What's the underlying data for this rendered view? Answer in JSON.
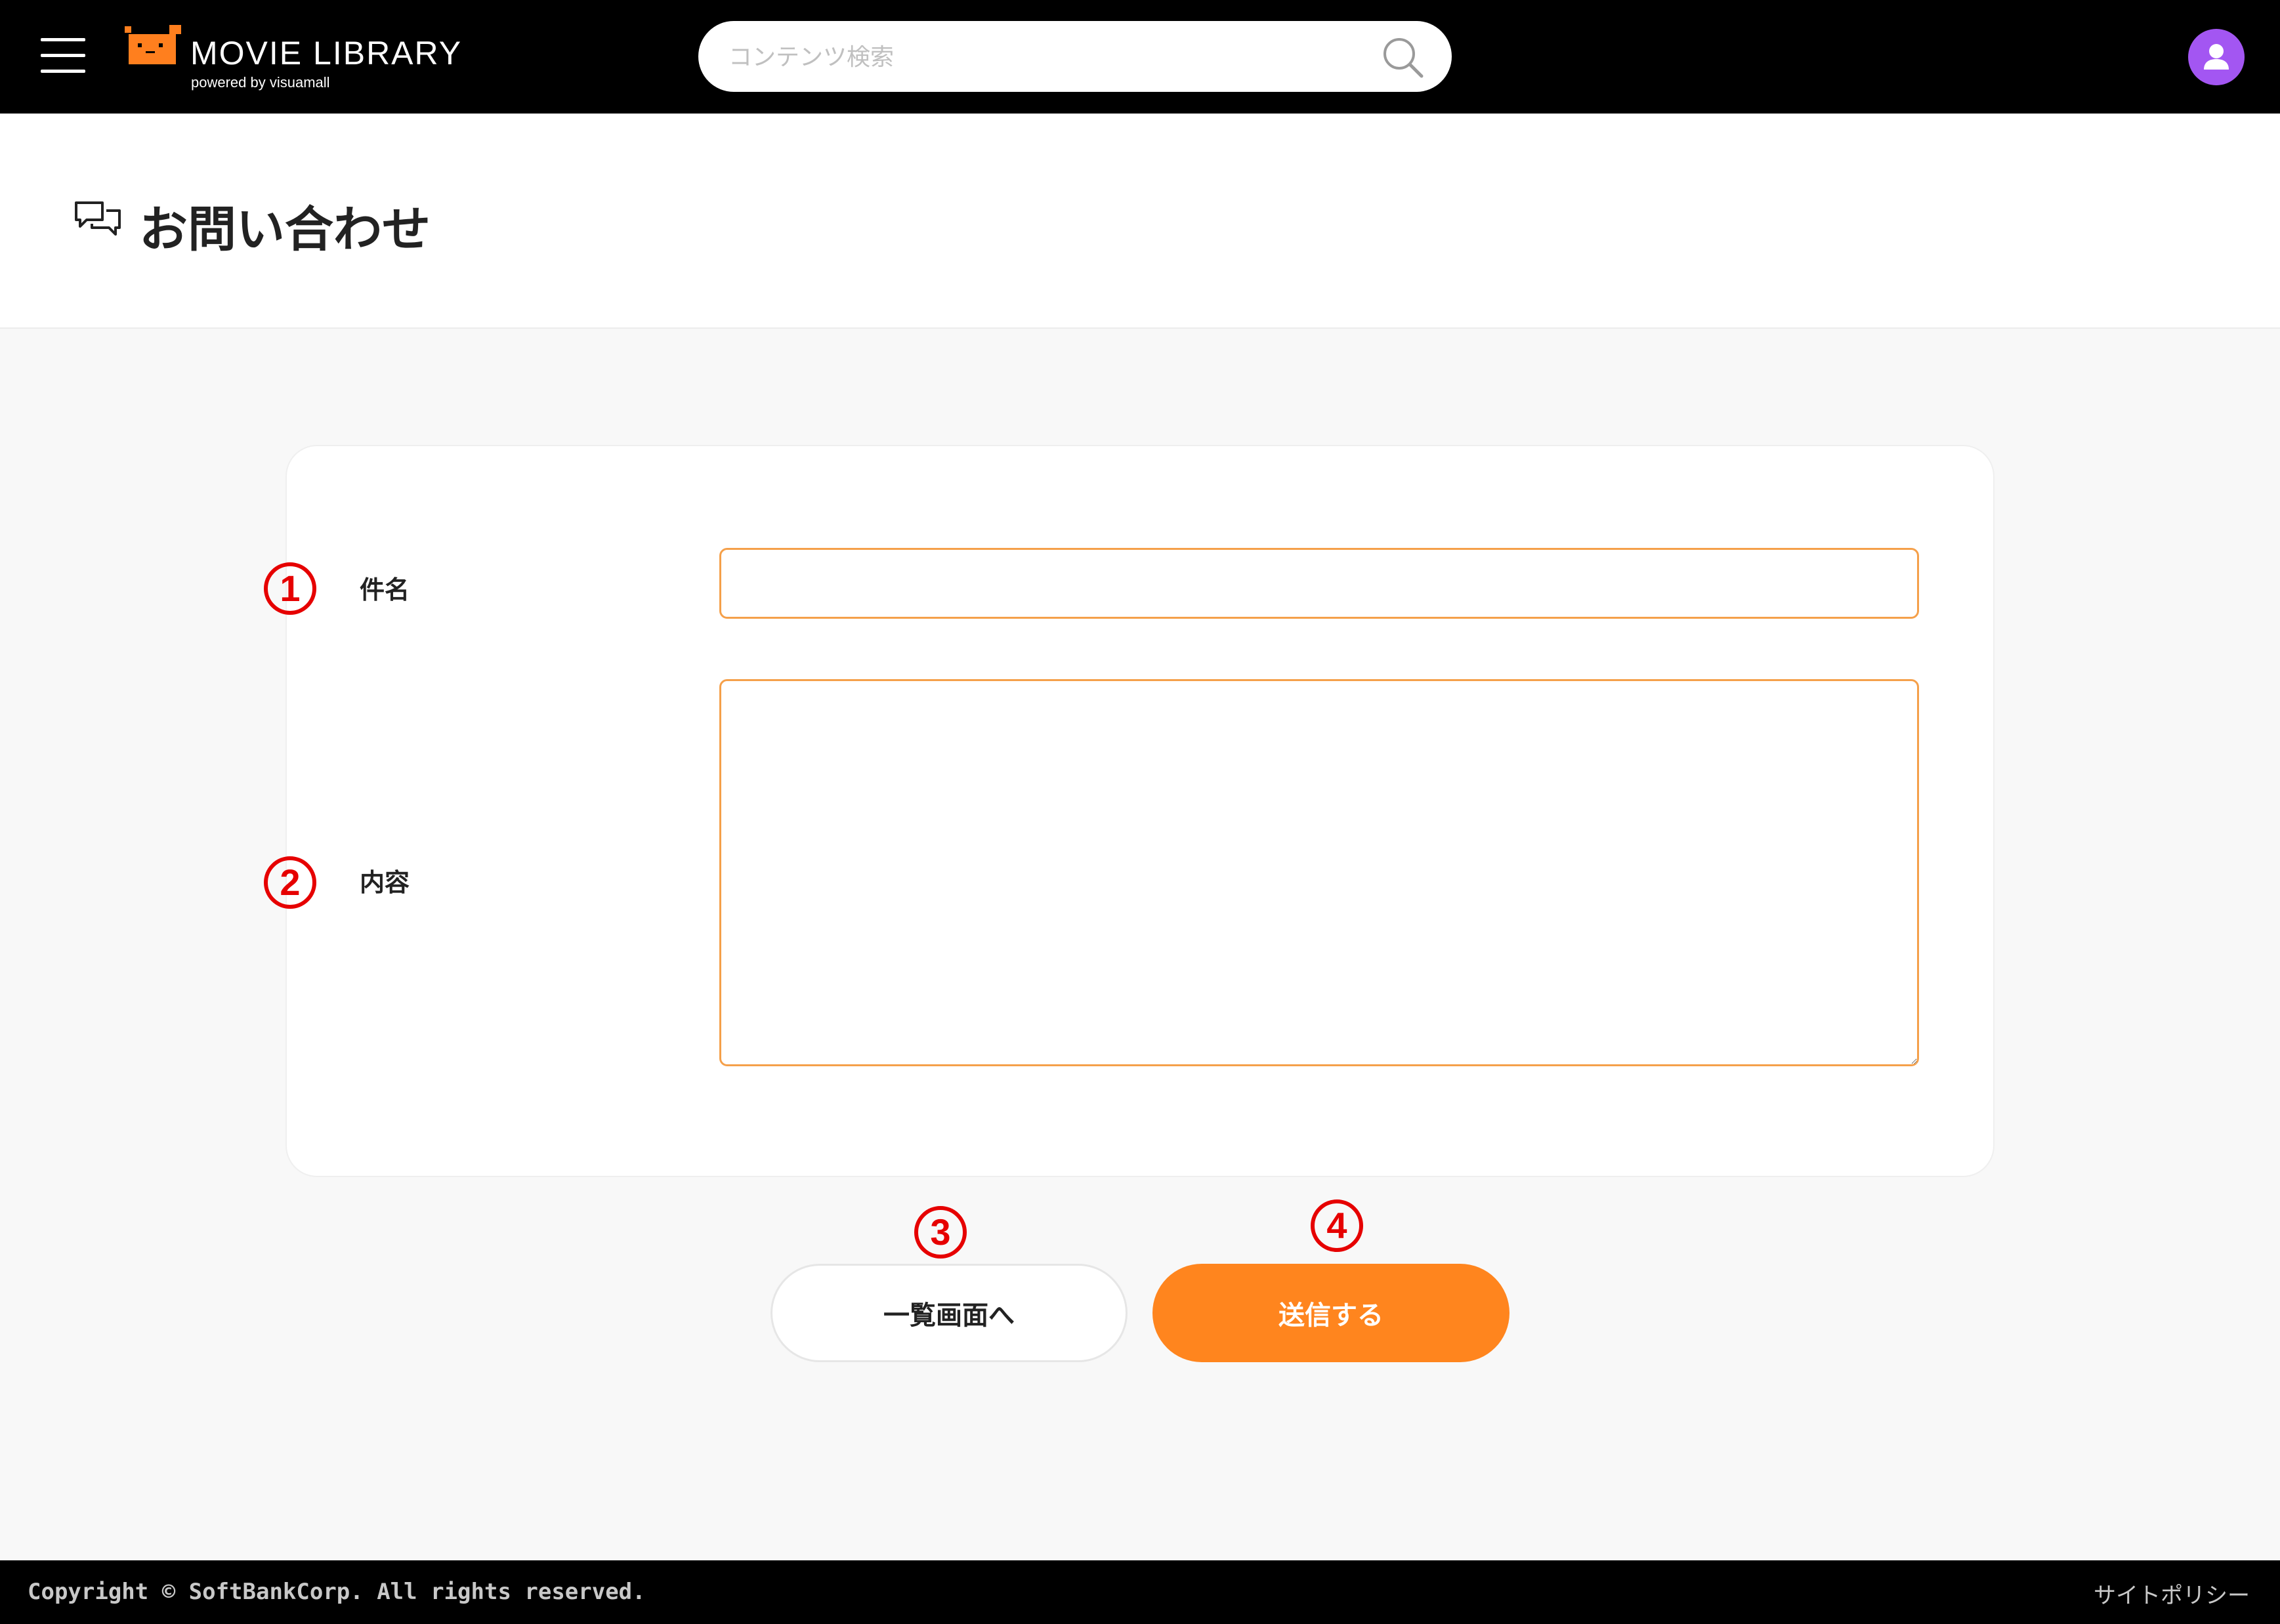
{
  "header": {
    "menu_icon": "hamburger-menu-icon",
    "logo_title": "MOVIE LIBRARY",
    "logo_subtitle": "powered by visuamall",
    "search_placeholder": "コンテンツ検索",
    "search_value": "",
    "search_icon": "search-icon",
    "user_icon": "user-avatar-icon"
  },
  "page": {
    "title": "お問い合わせ",
    "title_icon": "chat-bubbles-icon"
  },
  "form": {
    "subject": {
      "marker": "1",
      "label": "件名",
      "value": ""
    },
    "content": {
      "marker": "2",
      "label": "内容",
      "value": ""
    }
  },
  "actions": {
    "back": {
      "marker": "3",
      "label": "一覧画面へ"
    },
    "send": {
      "marker": "4",
      "label": "送信する"
    }
  },
  "footer": {
    "copyright": "Copyright © SoftBankCorp. All rights reserved.",
    "policy_link": "サイトポリシー"
  },
  "colors": {
    "header_bg": "#000000",
    "accent_orange": "#ff851e",
    "input_border": "#f5a04a",
    "avatar_purple": "#a356f2",
    "annotation_red": "#e60000",
    "page_bg": "#f8f8f8"
  }
}
